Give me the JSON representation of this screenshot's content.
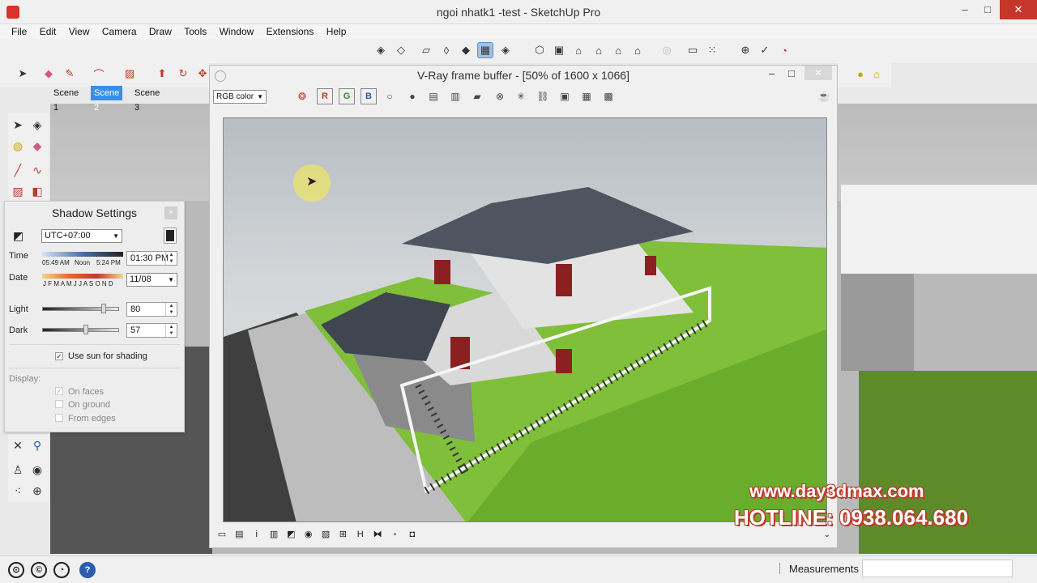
{
  "window": {
    "title": "ngoi nhatk1 -test - SketchUp Pro",
    "minimize": "–",
    "maximize": "□",
    "close": "✕"
  },
  "menu": [
    "File",
    "Edit",
    "View",
    "Camera",
    "Draw",
    "Tools",
    "Window",
    "Extensions",
    "Help"
  ],
  "scenes": [
    "Scene 1",
    "Scene 2",
    "Scene 3"
  ],
  "shadow_settings": {
    "title": "Shadow Settings",
    "close": "×",
    "timezone": "UTC+07:00",
    "time_label": "Time",
    "time_marks": [
      "05:49 AM",
      "Noon",
      "5:24 PM"
    ],
    "time_value": "01:30 PM",
    "date_label": "Date",
    "months": "J F M A M J J A S O N D",
    "date_value": "11/08",
    "light_label": "Light",
    "light_value": "80",
    "light_level": 0.8,
    "dark_label": "Dark",
    "dark_value": "57",
    "dark_level": 0.57,
    "use_sun_label": "Use sun for shading",
    "display_label": "Display:",
    "on_faces": "On faces",
    "on_ground": "On ground",
    "from_edges": "From edges"
  },
  "vfb": {
    "title": "V-Ray frame buffer - [50% of 1600 x 1066]",
    "channel": "RGB color",
    "r": "R",
    "g": "G",
    "b": "B",
    "minimize": "–",
    "maximize": "□",
    "close": "✕"
  },
  "watermark": {
    "site": "www.day3dmax.com",
    "hotline": "HOTLINE: 0938.064.680"
  },
  "status": {
    "measurements_label": "Measurements"
  },
  "colors": {
    "accent": "#3a8ee8",
    "close_red": "#c7362b",
    "watermark_red": "#c0392b"
  }
}
